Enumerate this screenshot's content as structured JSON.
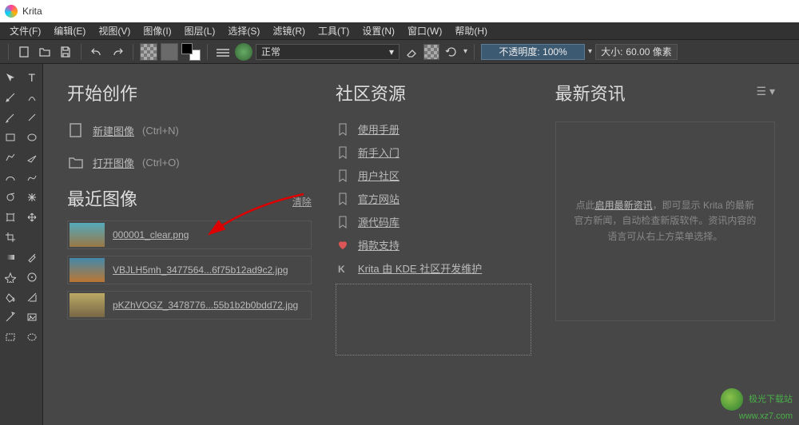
{
  "app": {
    "title": "Krita"
  },
  "menu": [
    "文件(F)",
    "编辑(E)",
    "视图(V)",
    "图像(I)",
    "图层(L)",
    "选择(S)",
    "滤镜(R)",
    "工具(T)",
    "设置(N)",
    "窗口(W)",
    "帮助(H)"
  ],
  "toolbar": {
    "blend_mode": "正常",
    "opacity_label": "不透明度:",
    "opacity_value": "100%",
    "size_label": "大小:",
    "size_value": "60.00 像素"
  },
  "start": {
    "title": "开始创作",
    "new_label": "新建图像",
    "new_shortcut": "(Ctrl+N)",
    "open_label": "打开图像",
    "open_shortcut": "(Ctrl+O)"
  },
  "recent": {
    "title": "最近图像",
    "clear": "清除",
    "items": [
      {
        "name": "000001_clear.png"
      },
      {
        "name": "VBJLH5mh_3477564...6f75b12ad9c2.jpg"
      },
      {
        "name": "pKZhVOGZ_3478776...55b1b2b0bdd72.jpg"
      }
    ]
  },
  "community": {
    "title": "社区资源",
    "links": [
      "使用手册",
      "新手入门",
      "用户社区",
      "官方网站",
      "源代码库"
    ],
    "donate": "捐款支持",
    "kde": "Krita 由 KDE 社区开发维护"
  },
  "news": {
    "title": "最新资讯",
    "enable": "启用最新资讯",
    "text_before": "点此",
    "text_after": "，即可显示 Krita 的最新官方新闻，自动检查新版软件。资讯内容的语言可从右上方菜单选择。"
  },
  "watermark": {
    "line1": "极光下载站",
    "line2": "www.xz7.com"
  }
}
